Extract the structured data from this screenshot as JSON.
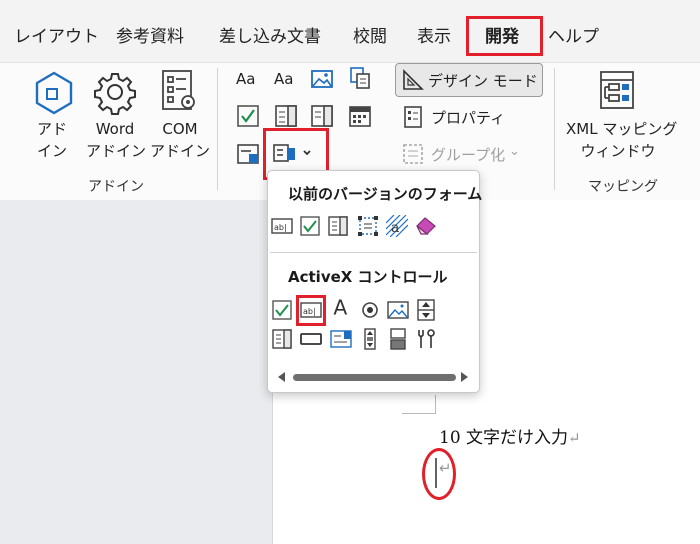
{
  "tabs": [
    {
      "label": "レイアウト"
    },
    {
      "label": "参考資料"
    },
    {
      "label": "差し込み文書"
    },
    {
      "label": "校閲"
    },
    {
      "label": "表示"
    },
    {
      "label": "開発"
    },
    {
      "label": "ヘルプ"
    }
  ],
  "active_tab": "開発",
  "ribbon": {
    "addins": {
      "buttons": [
        {
          "line1": "アド",
          "line2": "イン",
          "icon": "hexagon-addin-icon"
        },
        {
          "line1": "Word",
          "line2": "アドイン",
          "icon": "gear-icon"
        },
        {
          "line1": "COM",
          "line2": "アドイン",
          "icon": "com-addin-icon"
        }
      ],
      "group_label": "アドイン"
    },
    "controls": {
      "design_mode_label": "デザイン モード",
      "properties_label": "プロパティ",
      "group_label": "グループ化",
      "legacy_tools_icon": "legacy-tools-icon"
    },
    "mapping": {
      "line1": "XML マッピング",
      "line2": "ウィンドウ",
      "group_label": "マッピング"
    }
  },
  "dropdown": {
    "legacy_header": "以前のバージョンのフォーム",
    "activex_header": "ActiveX コントロール"
  },
  "document": {
    "text": "10 文字だけ入力",
    "para_mark": "↵"
  },
  "colors": {
    "highlight": "#e0202a",
    "icon_blue": "#1e6ebf",
    "checkbox_green": "#1f8f4e"
  }
}
